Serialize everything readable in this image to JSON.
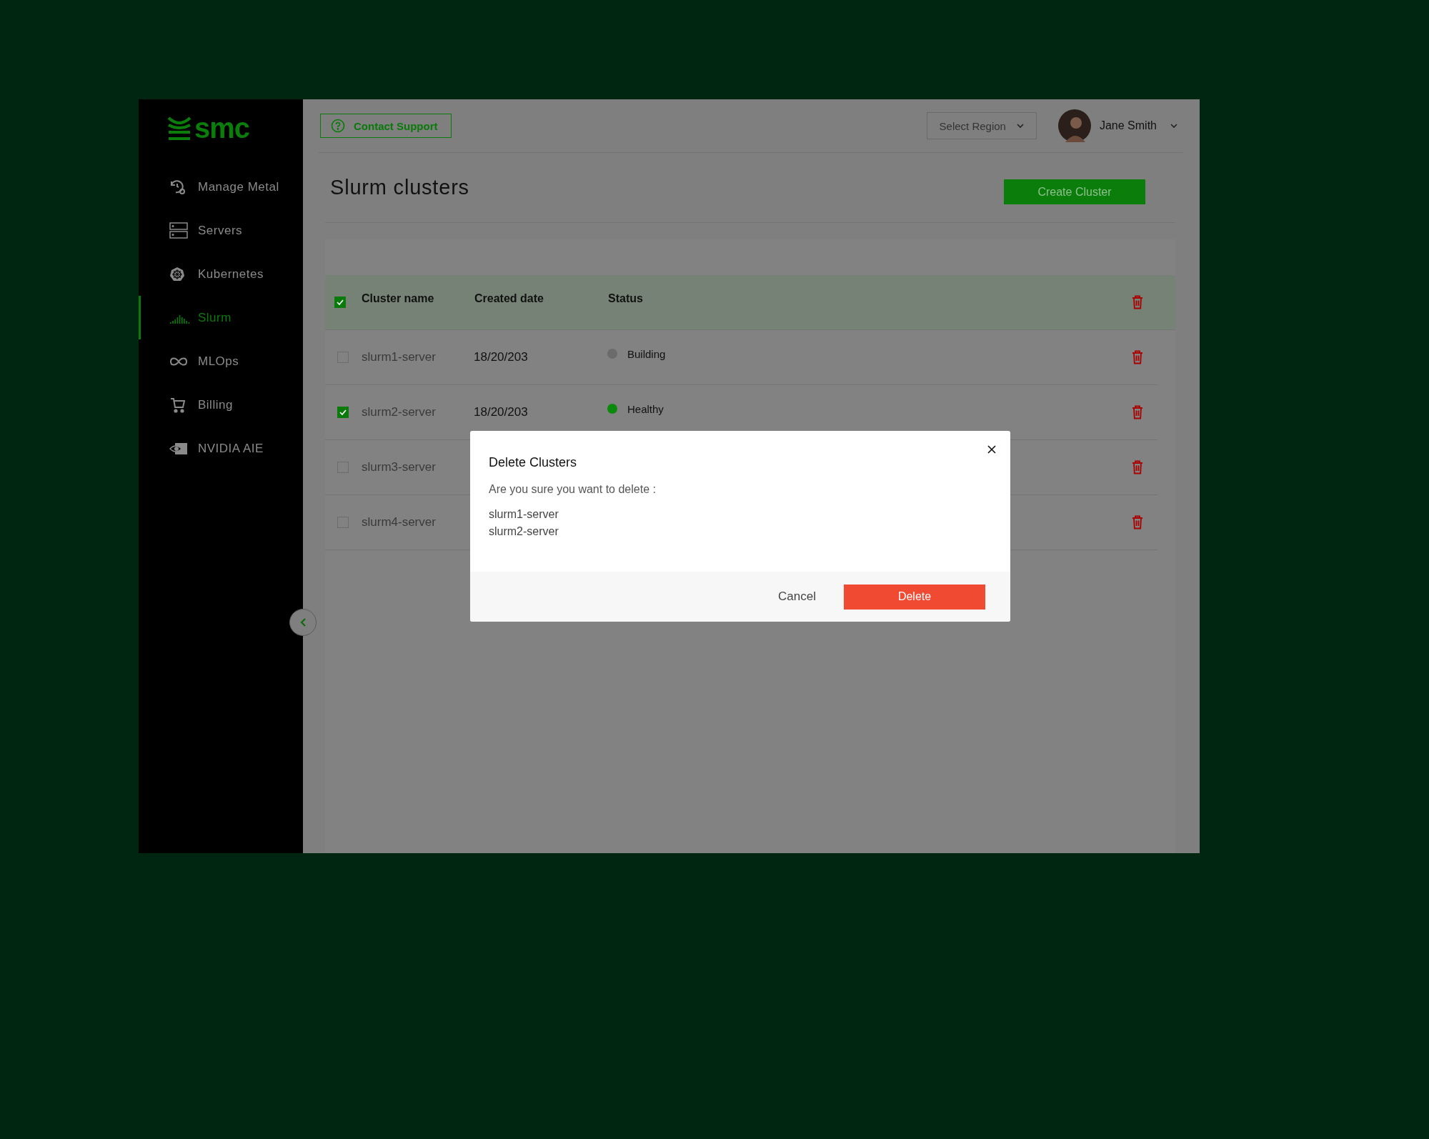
{
  "sidebar": {
    "logo": "smc",
    "items": [
      {
        "label": "Manage Metal",
        "kind": "metal",
        "selected": false
      },
      {
        "label": "Servers",
        "kind": "servers",
        "selected": false
      },
      {
        "label": "Kubernetes",
        "kind": "kubernetes",
        "selected": false
      },
      {
        "label": "Slurm",
        "kind": "slurm",
        "selected": true
      },
      {
        "label": "MLOps",
        "kind": "mlops",
        "selected": false
      },
      {
        "label": "Billing",
        "kind": "billing",
        "selected": false
      },
      {
        "label": "NVIDIA AIE",
        "kind": "nvidia",
        "selected": false
      }
    ]
  },
  "header": {
    "contact_support": "Contact Support",
    "region": {
      "placeholder": "Select Region"
    },
    "user": {
      "name": "Jane Smith"
    }
  },
  "page": {
    "title": "Slurm clusters",
    "create_button": "Create Cluster"
  },
  "table": {
    "all_checked": true,
    "columns": [
      "Cluster name",
      "Created date",
      "Status"
    ],
    "rows": [
      {
        "name": "slurm1-server",
        "date": "18/20/203",
        "status": {
          "label": "Building",
          "color": "#6b6b6b"
        },
        "checked": false
      },
      {
        "name": "slurm2-server",
        "date": "18/20/203",
        "status": {
          "label": "Healthy",
          "color": "#0a8a0a"
        },
        "checked": true
      },
      {
        "name": "slurm3-server",
        "checked": false
      },
      {
        "name": "slurm4-server",
        "checked": false
      }
    ]
  },
  "dialog": {
    "title": "Delete Clusters",
    "message": "Are you sure you want to delete :",
    "items": [
      "slurm1-server",
      "slurm2-server"
    ],
    "cancel": "Cancel",
    "confirm": "Delete"
  }
}
